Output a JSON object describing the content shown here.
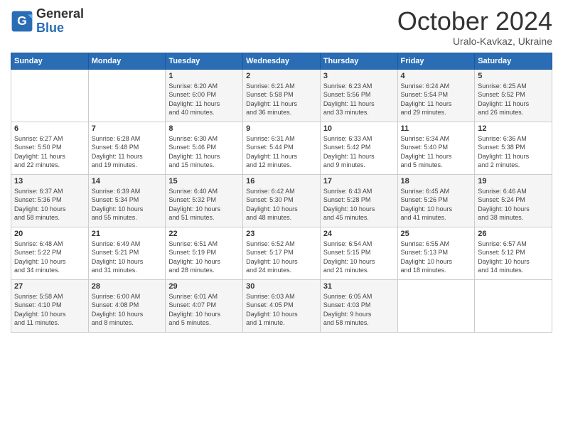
{
  "header": {
    "logo_general": "General",
    "logo_blue": "Blue",
    "month": "October 2024",
    "location": "Uralo-Kavkaz, Ukraine"
  },
  "weekdays": [
    "Sunday",
    "Monday",
    "Tuesday",
    "Wednesday",
    "Thursday",
    "Friday",
    "Saturday"
  ],
  "weeks": [
    [
      {
        "day": "",
        "info": ""
      },
      {
        "day": "",
        "info": ""
      },
      {
        "day": "1",
        "info": "Sunrise: 6:20 AM\nSunset: 6:00 PM\nDaylight: 11 hours\nand 40 minutes."
      },
      {
        "day": "2",
        "info": "Sunrise: 6:21 AM\nSunset: 5:58 PM\nDaylight: 11 hours\nand 36 minutes."
      },
      {
        "day": "3",
        "info": "Sunrise: 6:23 AM\nSunset: 5:56 PM\nDaylight: 11 hours\nand 33 minutes."
      },
      {
        "day": "4",
        "info": "Sunrise: 6:24 AM\nSunset: 5:54 PM\nDaylight: 11 hours\nand 29 minutes."
      },
      {
        "day": "5",
        "info": "Sunrise: 6:25 AM\nSunset: 5:52 PM\nDaylight: 11 hours\nand 26 minutes."
      }
    ],
    [
      {
        "day": "6",
        "info": "Sunrise: 6:27 AM\nSunset: 5:50 PM\nDaylight: 11 hours\nand 22 minutes."
      },
      {
        "day": "7",
        "info": "Sunrise: 6:28 AM\nSunset: 5:48 PM\nDaylight: 11 hours\nand 19 minutes."
      },
      {
        "day": "8",
        "info": "Sunrise: 6:30 AM\nSunset: 5:46 PM\nDaylight: 11 hours\nand 15 minutes."
      },
      {
        "day": "9",
        "info": "Sunrise: 6:31 AM\nSunset: 5:44 PM\nDaylight: 11 hours\nand 12 minutes."
      },
      {
        "day": "10",
        "info": "Sunrise: 6:33 AM\nSunset: 5:42 PM\nDaylight: 11 hours\nand 9 minutes."
      },
      {
        "day": "11",
        "info": "Sunrise: 6:34 AM\nSunset: 5:40 PM\nDaylight: 11 hours\nand 5 minutes."
      },
      {
        "day": "12",
        "info": "Sunrise: 6:36 AM\nSunset: 5:38 PM\nDaylight: 11 hours\nand 2 minutes."
      }
    ],
    [
      {
        "day": "13",
        "info": "Sunrise: 6:37 AM\nSunset: 5:36 PM\nDaylight: 10 hours\nand 58 minutes."
      },
      {
        "day": "14",
        "info": "Sunrise: 6:39 AM\nSunset: 5:34 PM\nDaylight: 10 hours\nand 55 minutes."
      },
      {
        "day": "15",
        "info": "Sunrise: 6:40 AM\nSunset: 5:32 PM\nDaylight: 10 hours\nand 51 minutes."
      },
      {
        "day": "16",
        "info": "Sunrise: 6:42 AM\nSunset: 5:30 PM\nDaylight: 10 hours\nand 48 minutes."
      },
      {
        "day": "17",
        "info": "Sunrise: 6:43 AM\nSunset: 5:28 PM\nDaylight: 10 hours\nand 45 minutes."
      },
      {
        "day": "18",
        "info": "Sunrise: 6:45 AM\nSunset: 5:26 PM\nDaylight: 10 hours\nand 41 minutes."
      },
      {
        "day": "19",
        "info": "Sunrise: 6:46 AM\nSunset: 5:24 PM\nDaylight: 10 hours\nand 38 minutes."
      }
    ],
    [
      {
        "day": "20",
        "info": "Sunrise: 6:48 AM\nSunset: 5:22 PM\nDaylight: 10 hours\nand 34 minutes."
      },
      {
        "day": "21",
        "info": "Sunrise: 6:49 AM\nSunset: 5:21 PM\nDaylight: 10 hours\nand 31 minutes."
      },
      {
        "day": "22",
        "info": "Sunrise: 6:51 AM\nSunset: 5:19 PM\nDaylight: 10 hours\nand 28 minutes."
      },
      {
        "day": "23",
        "info": "Sunrise: 6:52 AM\nSunset: 5:17 PM\nDaylight: 10 hours\nand 24 minutes."
      },
      {
        "day": "24",
        "info": "Sunrise: 6:54 AM\nSunset: 5:15 PM\nDaylight: 10 hours\nand 21 minutes."
      },
      {
        "day": "25",
        "info": "Sunrise: 6:55 AM\nSunset: 5:13 PM\nDaylight: 10 hours\nand 18 minutes."
      },
      {
        "day": "26",
        "info": "Sunrise: 6:57 AM\nSunset: 5:12 PM\nDaylight: 10 hours\nand 14 minutes."
      }
    ],
    [
      {
        "day": "27",
        "info": "Sunrise: 5:58 AM\nSunset: 4:10 PM\nDaylight: 10 hours\nand 11 minutes."
      },
      {
        "day": "28",
        "info": "Sunrise: 6:00 AM\nSunset: 4:08 PM\nDaylight: 10 hours\nand 8 minutes."
      },
      {
        "day": "29",
        "info": "Sunrise: 6:01 AM\nSunset: 4:07 PM\nDaylight: 10 hours\nand 5 minutes."
      },
      {
        "day": "30",
        "info": "Sunrise: 6:03 AM\nSunset: 4:05 PM\nDaylight: 10 hours\nand 1 minute."
      },
      {
        "day": "31",
        "info": "Sunrise: 6:05 AM\nSunset: 4:03 PM\nDaylight: 9 hours\nand 58 minutes."
      },
      {
        "day": "",
        "info": ""
      },
      {
        "day": "",
        "info": ""
      }
    ]
  ]
}
